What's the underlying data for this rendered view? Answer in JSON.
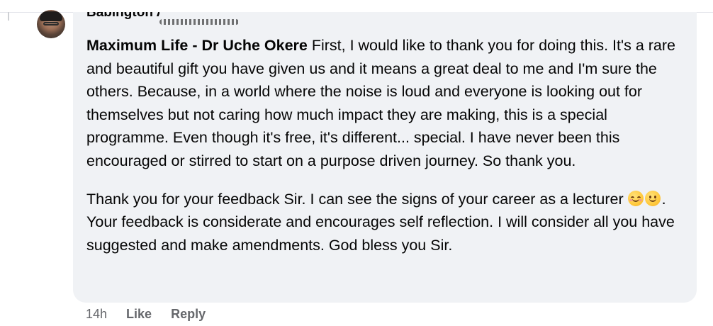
{
  "comment": {
    "author": "Babington Ab",
    "mention": "Maximum Life - Dr Uche Okere",
    "paragraph1_rest": " First, I would like to thank you for doing this. It's a rare and beautiful gift you have given us and it means a great deal to me and I'm sure the others. Because, in a world where the noise is loud and everyone is looking out for themselves but not caring how much impact they are making, this is a special programme. Even though it's free, it's different... special. I have never been this encouraged or stirred to start on a purpose driven journey. So thank you.",
    "paragraph2_before_emoji": "Thank you for your feedback Sir. I can see the signs of your career as a lecturer ",
    "paragraph2_after_emoji": ". Your feedback is considerate and encourages self reflection. I will consider all you have suggested and make amendments. God bless you Sir.",
    "emojis": [
      "smiling-face-with-smiling-eyes",
      "slightly-smiling-face"
    ]
  },
  "actions": {
    "time": "14h",
    "like": "Like",
    "reply": "Reply"
  },
  "colors": {
    "bubble": "#f0f2f5",
    "meta_text": "#65676b",
    "text": "#050505"
  }
}
